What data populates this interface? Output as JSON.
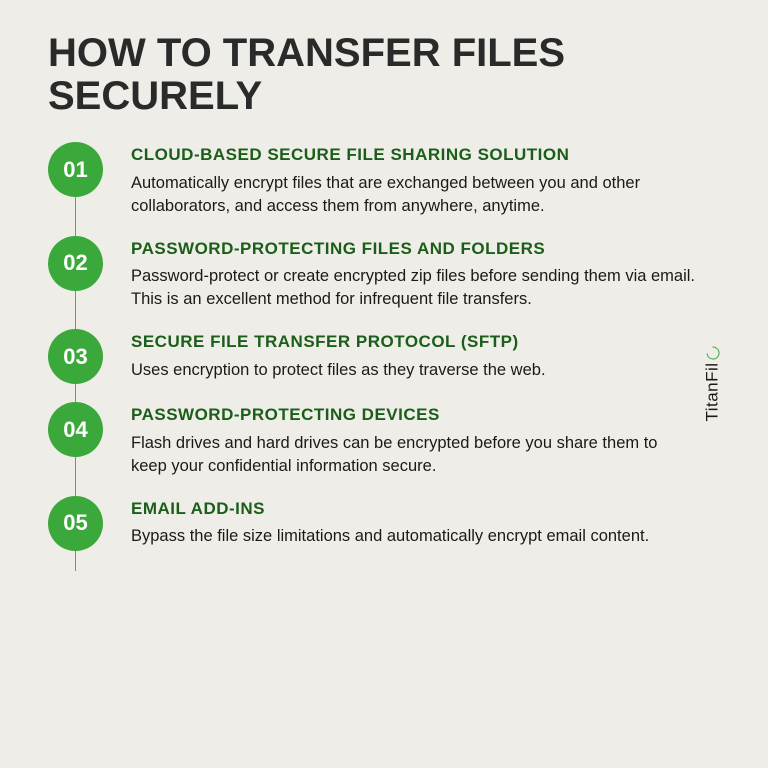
{
  "title": "HOW TO TRANSFER FILES SECURELY",
  "brand": "TitanFil",
  "items": [
    {
      "num": "01",
      "heading": "CLOUD-BASED SECURE FILE SHARING SOLUTION",
      "body": "Automatically encrypt files that are exchanged between you and other collaborators, and access them from anywhere, anytime."
    },
    {
      "num": "02",
      "heading": "PASSWORD-PROTECTING FILES AND FOLDERS",
      "body": "Password-protect or create encrypted zip files before sending them via email. This is an excellent method for infrequent file transfers."
    },
    {
      "num": "03",
      "heading": "SECURE FILE TRANSFER PROTOCOL (SFTP)",
      "body": "Uses encryption to protect files as they traverse the web."
    },
    {
      "num": "04",
      "heading": "PASSWORD-PROTECTING DEVICES",
      "body": "Flash drives and hard drives can be encrypted before you share them to keep your confidential information secure."
    },
    {
      "num": "05",
      "heading": "EMAIL ADD-INS",
      "body": "Bypass the file size limitations and automatically encrypt email content."
    }
  ]
}
